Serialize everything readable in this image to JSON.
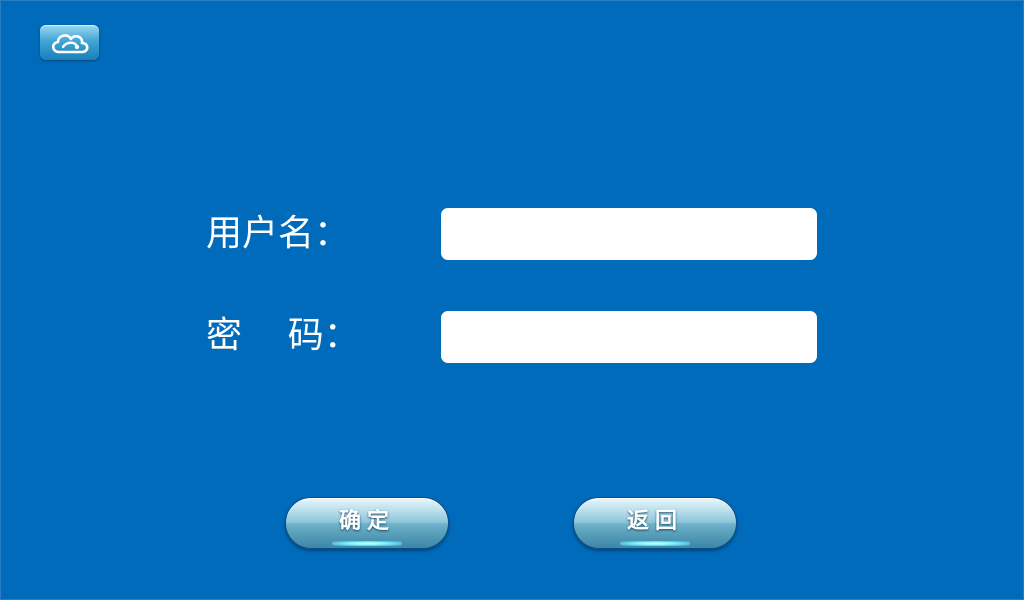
{
  "form": {
    "username_label": "用户名：",
    "password_label": "密    码：",
    "username_value": "",
    "password_value": ""
  },
  "buttons": {
    "confirm_label": "确定",
    "back_label": "返回"
  },
  "icons": {
    "logo": "cloud-logo-icon"
  },
  "colors": {
    "background": "#006bbb",
    "input_background": "#ffffff",
    "button_glow": "#6ff0ff"
  }
}
